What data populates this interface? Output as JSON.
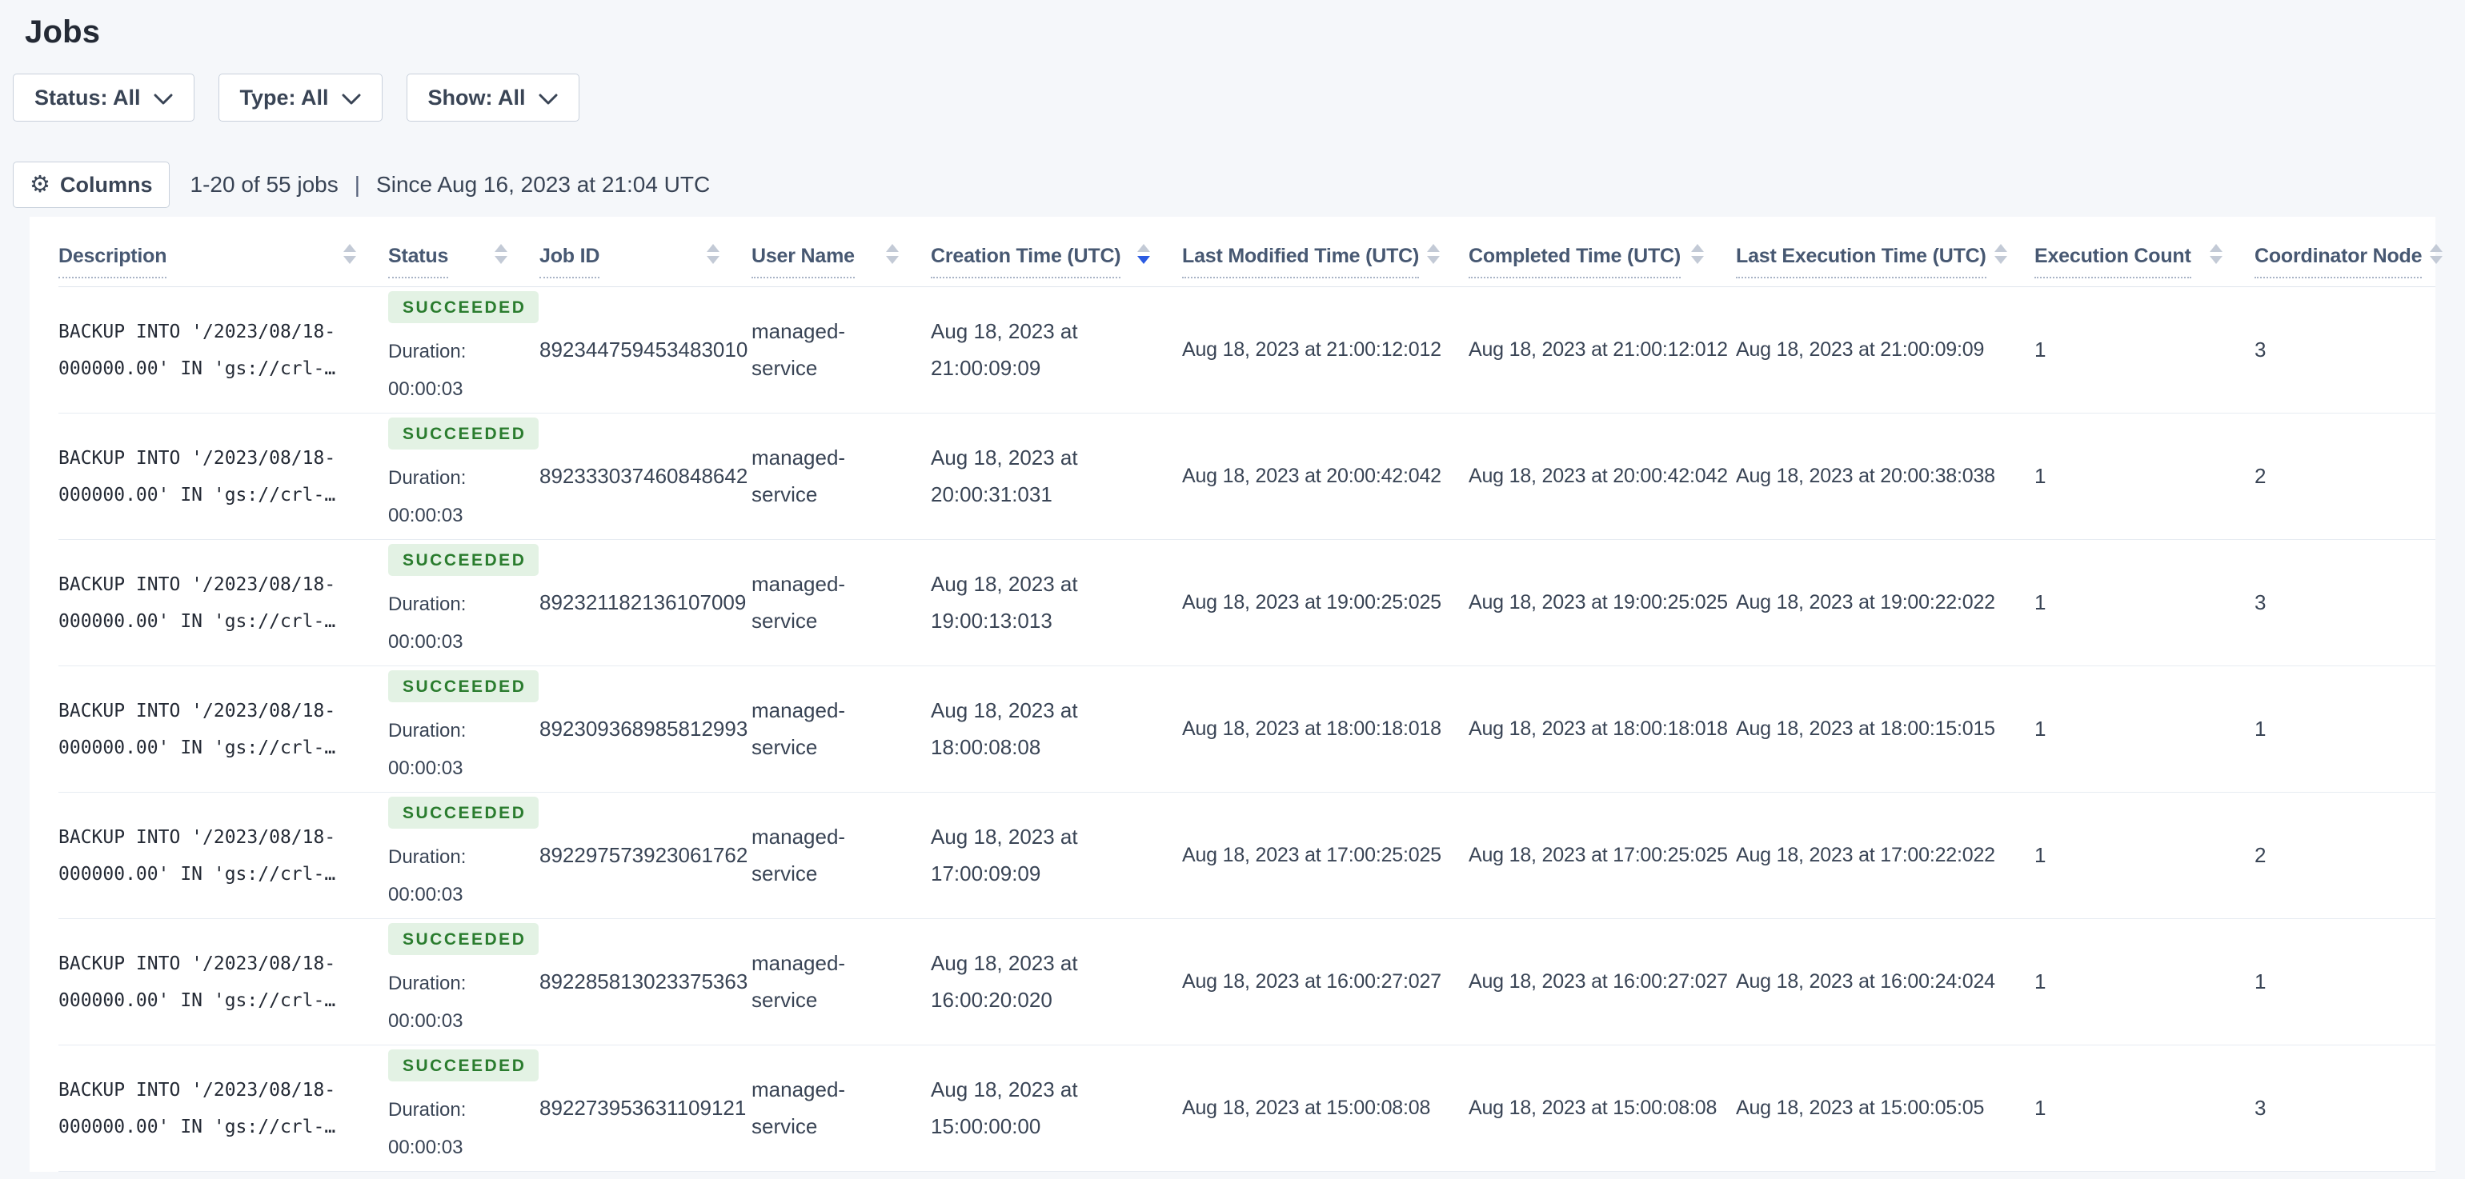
{
  "page": {
    "title": "Jobs"
  },
  "filters": [
    {
      "label": "Status: All"
    },
    {
      "label": "Type: All"
    },
    {
      "label": "Show: All"
    }
  ],
  "toolbar": {
    "columns_label": "Columns",
    "count_text": "1-20 of 55 jobs",
    "separator": "|",
    "since_text": "Since Aug 16, 2023 at 21:04 UTC"
  },
  "sort": {
    "column": "Creation Time (UTC)",
    "direction": "desc"
  },
  "colors": {
    "page_background": "#f5f7fa",
    "badge_background": "#e3f2e4",
    "badge_text": "#2a7c2e",
    "sort_active_arrow": "#2b5be2",
    "sort_inactive_arrow": "#c3cad6",
    "header_text": "#475872",
    "body_text": "#394455"
  },
  "table": {
    "headers": [
      {
        "label": "Description",
        "sorted": false
      },
      {
        "label": "Status",
        "sorted": false
      },
      {
        "label": "Job ID",
        "sorted": false
      },
      {
        "label": "User Name",
        "sorted": false
      },
      {
        "label": "Creation Time (UTC)",
        "sorted": true
      },
      {
        "label": "Last Modified Time (UTC)",
        "sorted": false
      },
      {
        "label": "Completed Time (UTC)",
        "sorted": false
      },
      {
        "label": "Last Execution Time (UTC)",
        "sorted": false
      },
      {
        "label": "Execution Count",
        "sorted": false
      },
      {
        "label": "Coordinator Node",
        "sorted": false
      }
    ],
    "rows": [
      {
        "description_line1": "BACKUP INTO '/2023/08/18-",
        "description_line2": "000000.00' IN 'gs://crl-…",
        "status": "SUCCEEDED",
        "duration_label": "Duration:",
        "duration": "00:00:03",
        "job_id": "892344759453483010",
        "user_line1": "managed-",
        "user_line2": "service",
        "created_line1": "Aug 18, 2023 at",
        "created_line2": "21:00:09:09",
        "last_modified": "Aug 18, 2023 at 21:00:12:012",
        "completed": "Aug 18, 2023 at 21:00:12:012",
        "last_execution": "Aug 18, 2023 at 21:00:09:09",
        "execution_count": "1",
        "coordinator_node": "3"
      },
      {
        "description_line1": "BACKUP INTO '/2023/08/18-",
        "description_line2": "000000.00' IN 'gs://crl-…",
        "status": "SUCCEEDED",
        "duration_label": "Duration:",
        "duration": "00:00:03",
        "job_id": "892333037460848642",
        "user_line1": "managed-",
        "user_line2": "service",
        "created_line1": "Aug 18, 2023 at",
        "created_line2": "20:00:31:031",
        "last_modified": "Aug 18, 2023 at 20:00:42:042",
        "completed": "Aug 18, 2023 at 20:00:42:042",
        "last_execution": "Aug 18, 2023 at 20:00:38:038",
        "execution_count": "1",
        "coordinator_node": "2"
      },
      {
        "description_line1": "BACKUP INTO '/2023/08/18-",
        "description_line2": "000000.00' IN 'gs://crl-…",
        "status": "SUCCEEDED",
        "duration_label": "Duration:",
        "duration": "00:00:03",
        "job_id": "892321182136107009",
        "user_line1": "managed-",
        "user_line2": "service",
        "created_line1": "Aug 18, 2023 at",
        "created_line2": "19:00:13:013",
        "last_modified": "Aug 18, 2023 at 19:00:25:025",
        "completed": "Aug 18, 2023 at 19:00:25:025",
        "last_execution": "Aug 18, 2023 at 19:00:22:022",
        "execution_count": "1",
        "coordinator_node": "3"
      },
      {
        "description_line1": "BACKUP INTO '/2023/08/18-",
        "description_line2": "000000.00' IN 'gs://crl-…",
        "status": "SUCCEEDED",
        "duration_label": "Duration:",
        "duration": "00:00:03",
        "job_id": "892309368985812993",
        "user_line1": "managed-",
        "user_line2": "service",
        "created_line1": "Aug 18, 2023 at",
        "created_line2": "18:00:08:08",
        "last_modified": "Aug 18, 2023 at 18:00:18:018",
        "completed": "Aug 18, 2023 at 18:00:18:018",
        "last_execution": "Aug 18, 2023 at 18:00:15:015",
        "execution_count": "1",
        "coordinator_node": "1"
      },
      {
        "description_line1": "BACKUP INTO '/2023/08/18-",
        "description_line2": "000000.00' IN 'gs://crl-…",
        "status": "SUCCEEDED",
        "duration_label": "Duration:",
        "duration": "00:00:03",
        "job_id": "892297573923061762",
        "user_line1": "managed-",
        "user_line2": "service",
        "created_line1": "Aug 18, 2023 at",
        "created_line2": "17:00:09:09",
        "last_modified": "Aug 18, 2023 at 17:00:25:025",
        "completed": "Aug 18, 2023 at 17:00:25:025",
        "last_execution": "Aug 18, 2023 at 17:00:22:022",
        "execution_count": "1",
        "coordinator_node": "2"
      },
      {
        "description_line1": "BACKUP INTO '/2023/08/18-",
        "description_line2": "000000.00' IN 'gs://crl-…",
        "status": "SUCCEEDED",
        "duration_label": "Duration:",
        "duration": "00:00:03",
        "job_id": "892285813023375363",
        "user_line1": "managed-",
        "user_line2": "service",
        "created_line1": "Aug 18, 2023 at",
        "created_line2": "16:00:20:020",
        "last_modified": "Aug 18, 2023 at 16:00:27:027",
        "completed": "Aug 18, 2023 at 16:00:27:027",
        "last_execution": "Aug 18, 2023 at 16:00:24:024",
        "execution_count": "1",
        "coordinator_node": "1"
      },
      {
        "description_line1": "BACKUP INTO '/2023/08/18-",
        "description_line2": "000000.00' IN 'gs://crl-…",
        "status": "SUCCEEDED",
        "duration_label": "Duration:",
        "duration": "00:00:03",
        "job_id": "892273953631109121",
        "user_line1": "managed-",
        "user_line2": "service",
        "created_line1": "Aug 18, 2023 at",
        "created_line2": "15:00:00:00",
        "last_modified": "Aug 18, 2023 at 15:00:08:08",
        "completed": "Aug 18, 2023 at 15:00:08:08",
        "last_execution": "Aug 18, 2023 at 15:00:05:05",
        "execution_count": "1",
        "coordinator_node": "3"
      }
    ]
  }
}
